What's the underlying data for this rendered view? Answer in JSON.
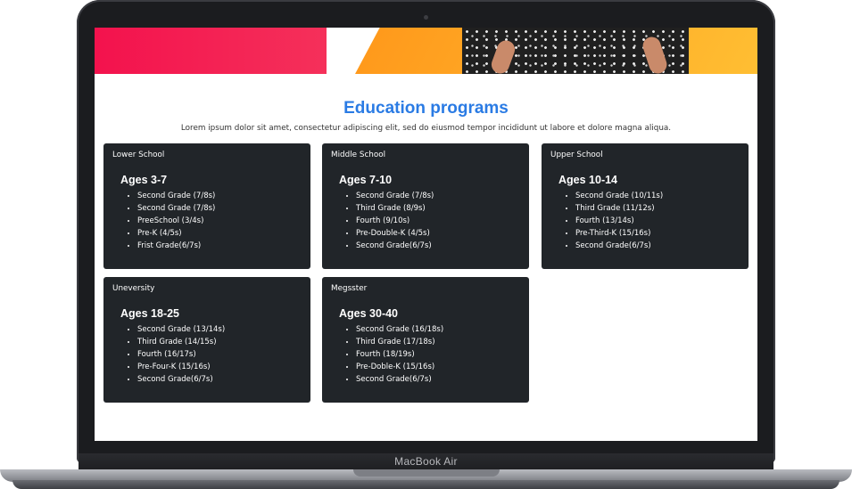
{
  "device": {
    "label": "MacBook Air"
  },
  "section": {
    "title": "Education programs",
    "subtitle": "Lorem ipsum dolor sit amet, consectetur adipiscing elit, sed do eiusmod tempor incididunt ut labore et dolore magna aliqua."
  },
  "programs": [
    {
      "name": "Lower School",
      "ages": "Ages 3-7",
      "items": [
        "Second Grade (7/8s)",
        "Second Grade (7/8s)",
        "PreeSchool (3/4s)",
        "Pre-K (4/5s)",
        "Frist Grade(6/7s)"
      ]
    },
    {
      "name": "Middle School",
      "ages": "Ages 7-10",
      "items": [
        "Second Grade (7/8s)",
        "Third Grade (8/9s)",
        "Fourth (9/10s)",
        "Pre-Double-K (4/5s)",
        "Second Grade(6/7s)"
      ]
    },
    {
      "name": "Upper School",
      "ages": "Ages 10-14",
      "items": [
        "Second Grade (10/11s)",
        "Third Grade (11/12s)",
        "Fourth (13/14s)",
        "Pre-Third-K (15/16s)",
        "Second Grade(6/7s)"
      ]
    },
    {
      "name": "Uneversity",
      "ages": "Ages 18-25",
      "items": [
        "Second Grade (13/14s)",
        "Third Grade (14/15s)",
        "Fourth (16/17s)",
        "Pre-Four-K (15/16s)",
        "Second Grade(6/7s)"
      ]
    },
    {
      "name": "Megsster",
      "ages": "Ages 30-40",
      "items": [
        "Second Grade (16/18s)",
        "Third Grade (17/18s)",
        "Fourth (18/19s)",
        "Pre-Doble-K (15/16s)",
        "Second Grade(6/7s)"
      ]
    }
  ],
  "colors": {
    "accent": "#2a7be4",
    "card": "#212529",
    "hero_pink": "#f3124d",
    "hero_orange": "#ffa726"
  }
}
